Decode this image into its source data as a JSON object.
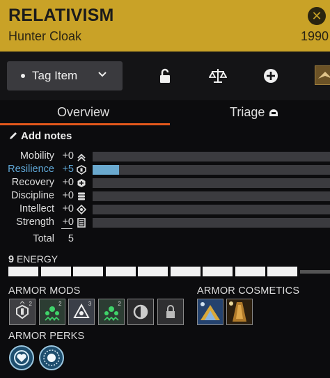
{
  "item": {
    "name": "RELATIVISM",
    "type": "Hunter Cloak",
    "power": "1990"
  },
  "header": {
    "close_icon": "close-icon",
    "accent_color": "#c9a227"
  },
  "toolbar": {
    "tag_label": "Tag Item",
    "icons": [
      "unlock-icon",
      "compare-scale-icon",
      "add-circle-icon",
      "ghost-shell-icon"
    ]
  },
  "tabs": [
    {
      "label": "Overview",
      "active": true
    },
    {
      "label": "Triage",
      "active": false
    }
  ],
  "notes": {
    "label": "Add notes"
  },
  "stats": [
    {
      "name": "Mobility",
      "value": "+0",
      "fill_fraction": 0,
      "icon": "mobility-icon",
      "highlight": false
    },
    {
      "name": "Resilience",
      "value": "+5",
      "fill_fraction": 0.11,
      "icon": "resilience-icon",
      "highlight": true
    },
    {
      "name": "Recovery",
      "value": "+0",
      "fill_fraction": 0,
      "icon": "recovery-icon",
      "highlight": false
    },
    {
      "name": "Discipline",
      "value": "+0",
      "fill_fraction": 0,
      "icon": "discipline-icon",
      "highlight": false
    },
    {
      "name": "Intellect",
      "value": "+0",
      "fill_fraction": 0,
      "icon": "intellect-icon",
      "highlight": false
    },
    {
      "name": "Strength",
      "value": "+0",
      "fill_fraction": 0,
      "icon": "strength-icon",
      "highlight": false
    }
  ],
  "total": {
    "label": "Total",
    "value": "5"
  },
  "energy": {
    "value": "9",
    "label": "ENERGY",
    "max": 10,
    "filled": 9
  },
  "armor_mods": {
    "label": "ARMOR MODS",
    "items": [
      {
        "icon": "resilience-mod-icon",
        "cost": "2"
      },
      {
        "icon": "recovery-mod-icon",
        "cost": "2"
      },
      {
        "icon": "arc-mod-icon",
        "cost": "3"
      },
      {
        "icon": "recovery-mod-icon",
        "cost": "2"
      },
      {
        "icon": "empty-socket-icon",
        "cost": ""
      },
      {
        "icon": "locked-socket-icon",
        "cost": ""
      }
    ]
  },
  "armor_cosmetics": {
    "label": "ARMOR COSMETICS",
    "items": [
      {
        "icon": "shader-icon"
      },
      {
        "icon": "ornament-icon"
      }
    ]
  },
  "armor_perks": {
    "label": "ARMOR PERKS",
    "items": [
      {
        "icon": "perk-heart-icon"
      },
      {
        "icon": "perk-sun-icon"
      }
    ]
  }
}
